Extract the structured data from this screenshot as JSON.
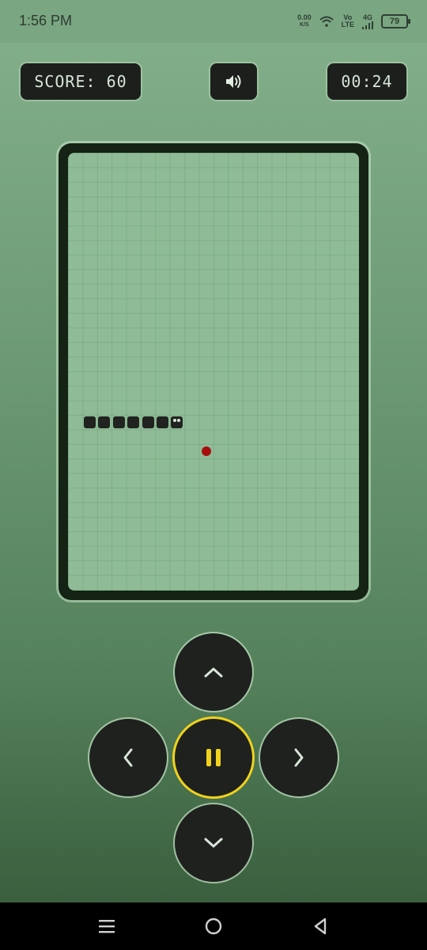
{
  "status_bar": {
    "time": "1:56 PM",
    "net_speed_value": "0.00",
    "net_speed_unit": "K/S",
    "volte_top": "Vo",
    "volte_bottom": "LTE",
    "network": "4G",
    "battery": "79"
  },
  "header": {
    "score_text": "SCORE: 60",
    "timer_text": "00:24",
    "sound_icon": "speaker-icon"
  },
  "game": {
    "snake_length": 7,
    "food_color": "#a80d0d"
  },
  "controls": {
    "up_icon": "chevron-up-icon",
    "left_icon": "chevron-left-icon",
    "pause_icon": "pause-icon",
    "right_icon": "chevron-right-icon",
    "down_icon": "chevron-down-icon",
    "pause_ring_color": "#f0d21c"
  },
  "nav_bar": {
    "menu_icon": "menu-icon",
    "home_icon": "home-icon",
    "back_icon": "back-icon"
  }
}
